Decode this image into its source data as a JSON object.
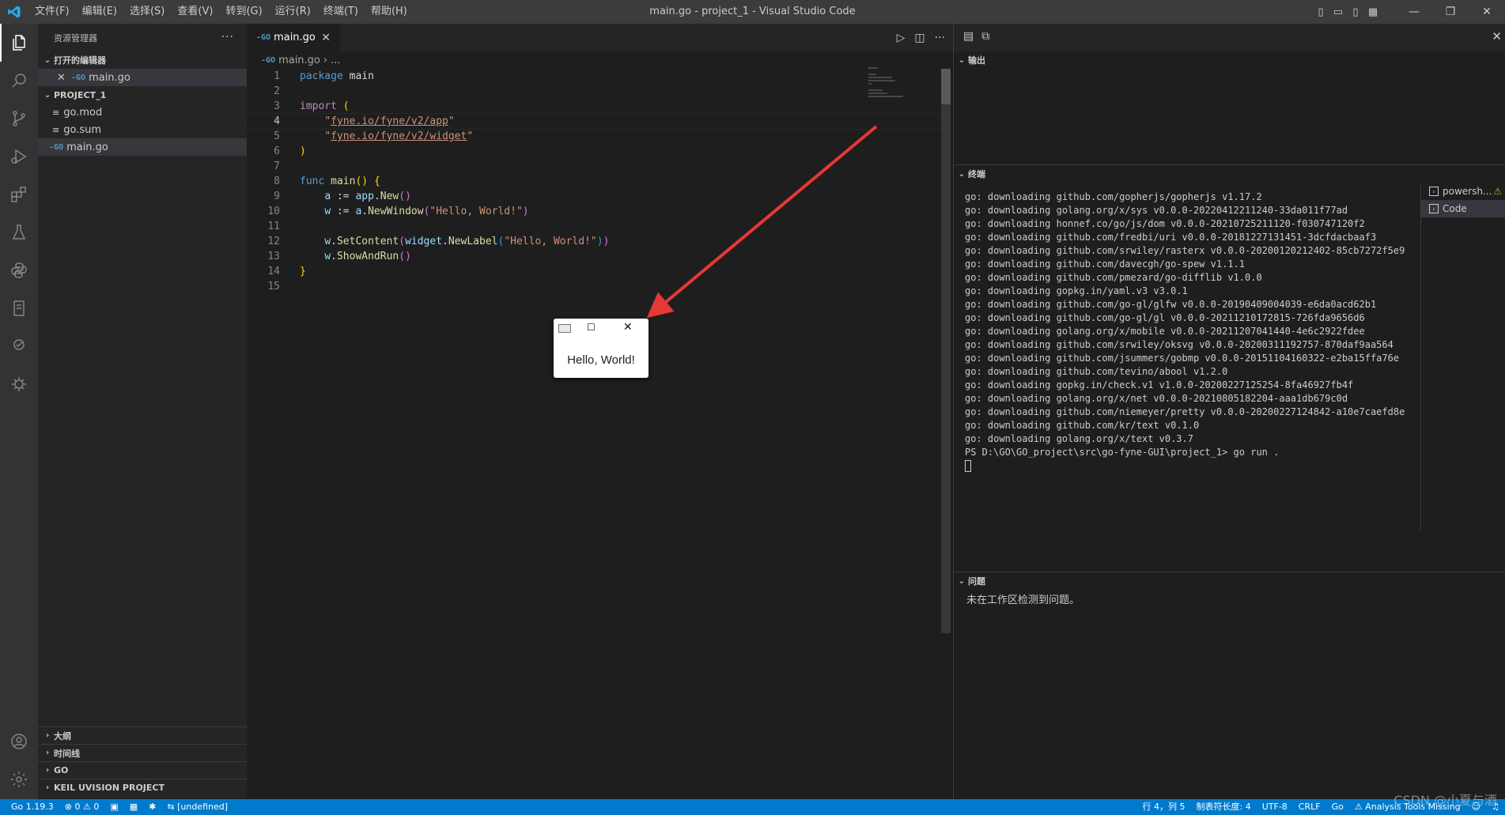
{
  "titlebar": {
    "menus": [
      "文件(F)",
      "编辑(E)",
      "选择(S)",
      "查看(V)",
      "转到(G)",
      "运行(R)",
      "终端(T)",
      "帮助(H)"
    ],
    "title": "main.go - project_1 - Visual Studio Code"
  },
  "sidebar": {
    "header": "资源管理器",
    "open_editors_title": "打开的编辑器",
    "open_editor_file": "main.go",
    "project_title": "PROJECT_1",
    "files": [
      "go.mod",
      "go.sum",
      "main.go"
    ],
    "bottom_sections": [
      "大纲",
      "时间线",
      "GO",
      "KEIL UVISION PROJECT"
    ]
  },
  "editor": {
    "tab_label": "main.go",
    "breadcrumb_file": "main.go",
    "breadcrumb_more": "...",
    "current_line": 4,
    "line_numbers": [
      "1",
      "2",
      "3",
      "4",
      "5",
      "6",
      "7",
      "8",
      "9",
      "10",
      "11",
      "12",
      "13",
      "14",
      "15"
    ]
  },
  "hello_window": {
    "text": "Hello, World!"
  },
  "panel": {
    "output_title": "输出",
    "terminal_title": "终端",
    "terminal_lines": [
      "go: downloading github.com/gopherjs/gopherjs v1.17.2",
      "go: downloading golang.org/x/sys v0.0.0-20220412211240-33da011f77ad",
      "go: downloading honnef.co/go/js/dom v0.0.0-20210725211120-f030747120f2",
      "go: downloading github.com/fredbi/uri v0.0.0-20181227131451-3dcfdacbaaf3",
      "go: downloading github.com/srwiley/rasterx v0.0.0-20200120212402-85cb7272f5e9",
      "go: downloading github.com/davecgh/go-spew v1.1.1",
      "go: downloading github.com/pmezard/go-difflib v1.0.0",
      "go: downloading gopkg.in/yaml.v3 v3.0.1",
      "go: downloading github.com/go-gl/glfw v0.0.0-20190409004039-e6da0acd62b1",
      "go: downloading github.com/go-gl/gl v0.0.0-20211210172815-726fda9656d6",
      "go: downloading golang.org/x/mobile v0.0.0-20211207041440-4e6c2922fdee",
      "go: downloading github.com/srwiley/oksvg v0.0.0-20200311192757-870daf9aa564",
      "go: downloading github.com/jsummers/gobmp v0.0.0-20151104160322-e2ba15ffa76e",
      "go: downloading github.com/tevino/abool v1.2.0",
      "go: downloading gopkg.in/check.v1 v1.0.0-20200227125254-8fa46927fb4f",
      "go: downloading golang.org/x/net v0.0.0-20210805182204-aaa1db679c0d",
      "go: downloading github.com/niemeyer/pretty v0.0.0-20200227124842-a10e7caefd8e",
      "go: downloading github.com/kr/text v0.1.0",
      "go: downloading golang.org/x/text v0.3.7",
      "PS D:\\GO\\GO_project\\src\\go-fyne-GUI\\project_1> go run ."
    ],
    "terminal_tabs": [
      "powersh...",
      "Code"
    ],
    "problems_title": "问题",
    "problems_message": "未在工作区检测到问题。"
  },
  "statusbar": {
    "go_version": "Go 1.19.3",
    "errors": "0",
    "warnings": "0",
    "undefined": "[undefined]",
    "position": "行 4，列 5",
    "tab_size": "制表符长度: 4",
    "encoding": "UTF-8",
    "eol": "CRLF",
    "language": "Go",
    "analysis": "Analysis Tools Missing"
  },
  "watermark": "CSDN @小夏与酒",
  "colors": {
    "statusbar": "#007acc",
    "editor_bg": "#1e1e1e",
    "sidebar_bg": "#252526",
    "activitybar_bg": "#333333",
    "arrow": "#e53935"
  }
}
